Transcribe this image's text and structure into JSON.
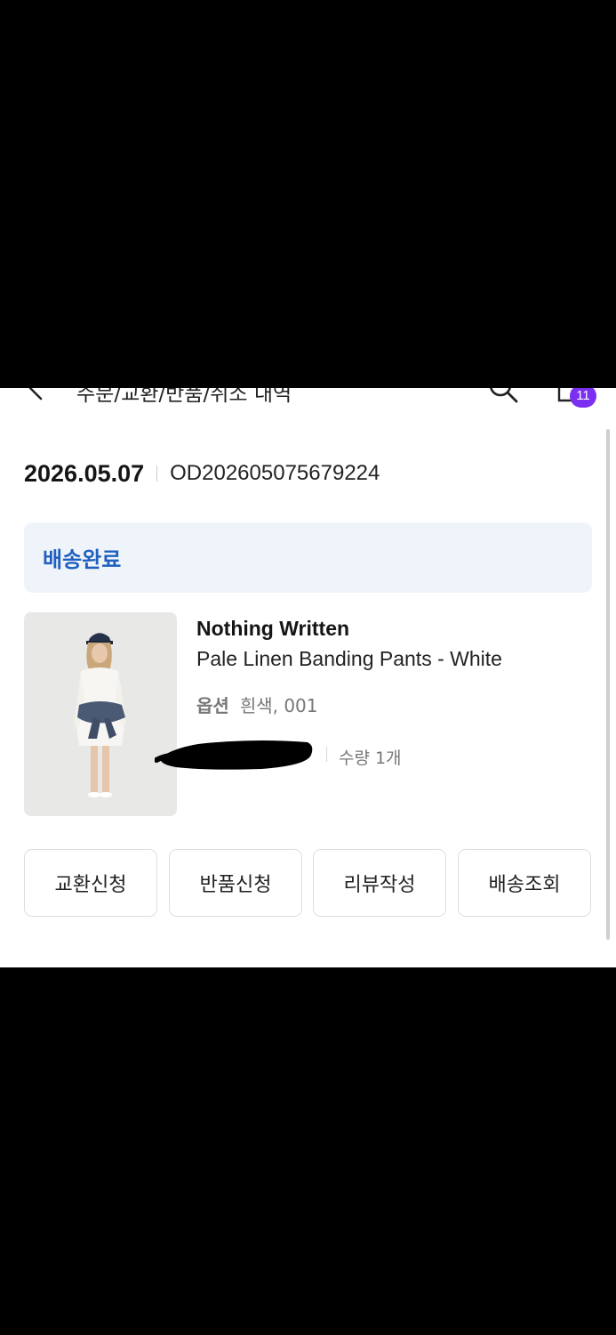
{
  "header": {
    "title": "주문/교환/반품/취소 내역",
    "cart_badge_count": "11",
    "back_icon": "chevron-left-icon",
    "search_icon": "search-icon",
    "cart_icon": "cart-icon",
    "badge_color": "#7b2ff0"
  },
  "order": {
    "date": "2026.05.07",
    "number": "OD202605075679224"
  },
  "status": {
    "label": "배송완료",
    "color": "#1f5fbf",
    "background": "#eff4fa"
  },
  "product": {
    "brand": "Nothing Written",
    "name": "Pale Linen Banding Pants - White",
    "option_label": "옵션",
    "option_value": "흰색, 001",
    "quantity_label": "수량",
    "quantity_value": "1개"
  },
  "actions": [
    {
      "label": "교환신청"
    },
    {
      "label": "반품신청"
    },
    {
      "label": "리뷰작성"
    },
    {
      "label": "배송조회"
    }
  ]
}
